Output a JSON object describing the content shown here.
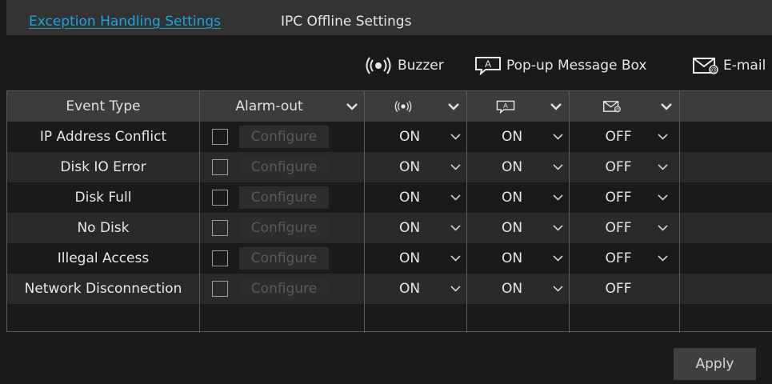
{
  "tabs": [
    {
      "label": "Exception Handling Settings",
      "active": true
    },
    {
      "label": "IPC Offline Settings",
      "active": false
    }
  ],
  "legend": {
    "buzzer": "Buzzer",
    "popup": "Pop-up Message Box",
    "email": "E-mail"
  },
  "table": {
    "headers": {
      "event_type": "Event Type",
      "alarm_out": "Alarm-out"
    },
    "rows": [
      {
        "event": "IP Address Conflict",
        "configure": "Configure",
        "buzzer": "ON",
        "popup": "ON",
        "email": "OFF",
        "email_dropdown": true
      },
      {
        "event": "Disk IO Error",
        "configure": "Configure",
        "buzzer": "ON",
        "popup": "ON",
        "email": "OFF",
        "email_dropdown": true
      },
      {
        "event": "Disk Full",
        "configure": "Configure",
        "buzzer": "ON",
        "popup": "ON",
        "email": "OFF",
        "email_dropdown": true
      },
      {
        "event": "No Disk",
        "configure": "Configure",
        "buzzer": "ON",
        "popup": "ON",
        "email": "OFF",
        "email_dropdown": true
      },
      {
        "event": "Illegal Access",
        "configure": "Configure",
        "buzzer": "ON",
        "popup": "ON",
        "email": "OFF",
        "email_dropdown": true
      },
      {
        "event": "Network Disconnection",
        "configure": "Configure",
        "buzzer": "ON",
        "popup": "ON",
        "email": "OFF",
        "email_dropdown": false
      }
    ]
  },
  "apply_label": "Apply",
  "colors": {
    "accent": "#1ea5d8",
    "background": "#1a1a1a",
    "tabbar": "#333333"
  },
  "icons": [
    "buzzer-icon",
    "popup-message-icon",
    "email-icon",
    "chevron-down-icon"
  ]
}
